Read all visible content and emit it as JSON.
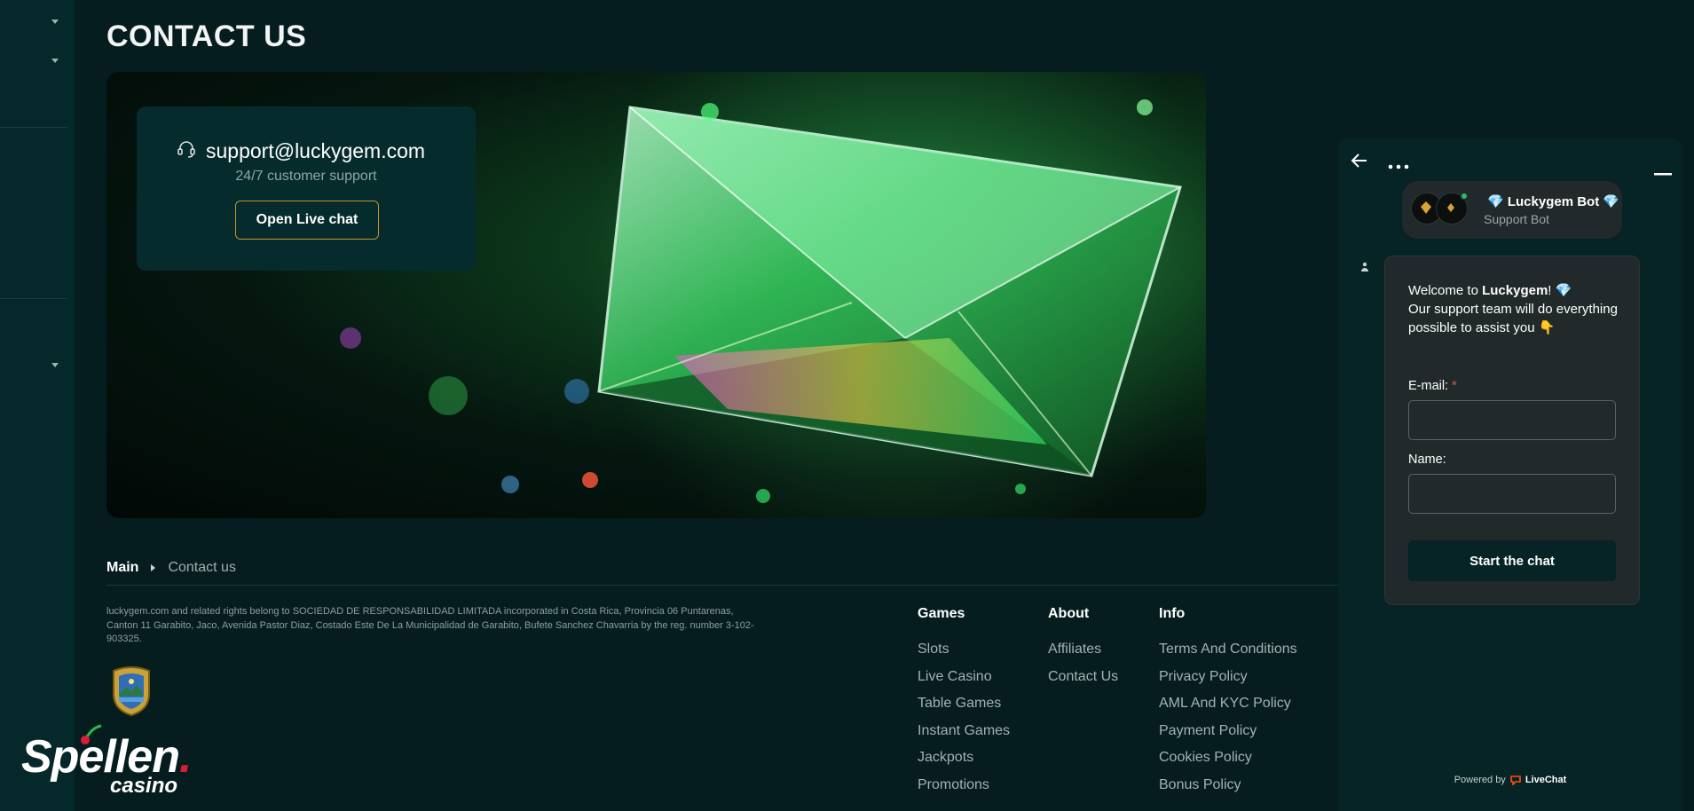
{
  "page": {
    "title": "CONTACT US"
  },
  "contact": {
    "email": "support@luckygem.com",
    "subtitle": "24/7 customer support",
    "button": "Open Live chat"
  },
  "breadcrumb": {
    "main": "Main",
    "current": "Contact us"
  },
  "legal": "luckygem.com and related rights belong to SOCIEDAD DE RESPONSABILIDAD LIMITADA incorporated in Costa Rica, Provincia 06 Puntarenas, Canton 11 Garabito, Jaco, Avenida Pastor Diaz, Costado Este De La Municipalidad de Garabito, Bufete Sanchez Chavarria by the reg. number 3-102-903325.",
  "footer": {
    "games": {
      "heading": "Games",
      "links": [
        "Slots",
        "Live Casino",
        "Table Games",
        "Instant Games",
        "Jackpots",
        "Promotions"
      ]
    },
    "about": {
      "heading": "About",
      "links": [
        "Affiliates",
        "Contact Us"
      ]
    },
    "info": {
      "heading": "Info",
      "links": [
        "Terms And Conditions",
        "Privacy Policy",
        "AML And KYC Policy",
        "Payment Policy",
        "Cookies Policy",
        "Bonus Policy"
      ]
    }
  },
  "brand": {
    "name_a": "Sp",
    "name_b": "ellen",
    "dot": ".",
    "sub": "casino"
  },
  "chat": {
    "bot_name": "💎 Luckygem Bot 💎",
    "bot_role": "Support Bot",
    "welcome_prefix": "Welcome to ",
    "welcome_brand": "Luckygem",
    "welcome_suffix": "! 💎",
    "welcome_body": "Our support team will do everything possible to assist you 👇",
    "email_label": "E-mail:",
    "required_mark": "*",
    "name_label": "Name:",
    "start_button": "Start the chat",
    "powered_by": "Powered by",
    "provider": "LiveChat"
  },
  "colors": {
    "accent_gold": "#c9912a",
    "chat_bg": "#062326",
    "livechat_red": "#ff5100"
  }
}
